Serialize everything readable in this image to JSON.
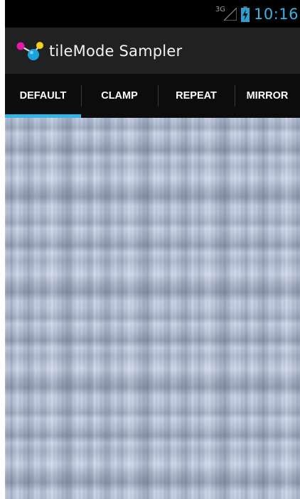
{
  "status_bar": {
    "network_type": "3G",
    "clock": "10:16",
    "icons": [
      "signal-icon",
      "battery-charging-icon"
    ],
    "accent_color": "#33b5e5"
  },
  "action_bar": {
    "title": "tileMode Sampler",
    "icon": "molecule-app-icon"
  },
  "tabs": [
    {
      "label": "DEFAULT",
      "selected": true
    },
    {
      "label": "CLAMP",
      "selected": false
    },
    {
      "label": "REPEAT",
      "selected": false
    },
    {
      "label": "MIRROR",
      "selected": false
    }
  ],
  "content": {
    "kind": "tiled-bitmap",
    "base_color": "#c3cfe3"
  },
  "colors": {
    "status_bar_bg": "#000000",
    "action_bar_bg": "#212121",
    "tab_bar_bg": "#0c0c0c",
    "tab_indicator": "#33b5e5"
  }
}
